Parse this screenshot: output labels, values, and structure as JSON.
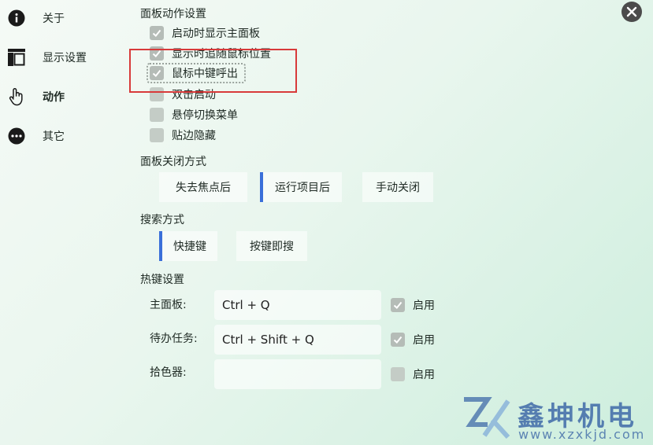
{
  "sidebar": {
    "items": [
      {
        "label": "关于",
        "icon": "info-icon"
      },
      {
        "label": "显示设置",
        "icon": "layout-icon"
      },
      {
        "label": "动作",
        "icon": "hand-pointer-icon",
        "active": true
      },
      {
        "label": "其它",
        "icon": "more-icon"
      }
    ]
  },
  "panel_actions": {
    "title": "面板动作设置",
    "options": [
      {
        "label": "启动时显示主面板",
        "checked": true
      },
      {
        "label": "显示时追随鼠标位置",
        "checked": true
      },
      {
        "label": "鼠标中键呼出",
        "checked": true,
        "focused": true
      },
      {
        "label": "双击启动",
        "checked": false
      },
      {
        "label": "悬停切换菜单",
        "checked": false
      },
      {
        "label": "贴边隐藏",
        "checked": false
      }
    ]
  },
  "close_mode": {
    "title": "面板关闭方式",
    "options": [
      "失去焦点后",
      "运行项目后",
      "手动关闭"
    ],
    "selected": "运行项目后"
  },
  "search_mode": {
    "title": "搜索方式",
    "options": [
      "快捷键",
      "按键即搜"
    ],
    "selected": "快捷键"
  },
  "hotkeys": {
    "title": "热键设置",
    "rows": [
      {
        "label": "主面板:",
        "value": "Ctrl + Q",
        "enabled_label": "启用",
        "enabled": true
      },
      {
        "label": "待办任务:",
        "value": "Ctrl + Shift + Q",
        "enabled_label": "启用",
        "enabled": true
      },
      {
        "label": "拾色器:",
        "value": "",
        "enabled_label": "启用",
        "enabled": false
      }
    ]
  },
  "watermark": {
    "text": "鑫坤机电",
    "url": "www.xzxkjd.com"
  },
  "colors": {
    "accent": "#3a6fd9",
    "highlight_box": "#d83a3a"
  }
}
